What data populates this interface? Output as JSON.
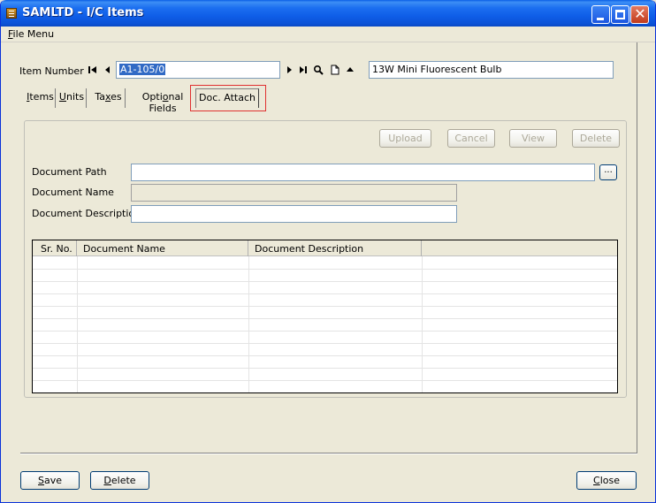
{
  "window": {
    "title": "SAMLTD - I/C Items",
    "accent": "#0a5fe6"
  },
  "menu": {
    "file_menu_u": "F",
    "file_menu_rest": "ile Menu"
  },
  "item": {
    "label": "Item Number",
    "number": "A1-105/0",
    "description": "13W Mini Fluorescent Bulb"
  },
  "tabs": [
    {
      "pre": "",
      "u": "I",
      "post": "tems"
    },
    {
      "pre": "",
      "u": "U",
      "post": "nits"
    },
    {
      "pre": "Ta",
      "u": "x",
      "post": "es"
    },
    {
      "pre": "Opti",
      "u": "o",
      "post": "nal Fields"
    },
    {
      "pre": "Doc. Attach",
      "u": "",
      "post": ""
    }
  ],
  "actions": {
    "upload": "Upload",
    "cancel": "Cancel",
    "view": "View",
    "delete": "Delete"
  },
  "form": {
    "document_path_label": "Document Path",
    "document_name_label": "Document Name",
    "document_description_label": "Document Description",
    "browse_label": "..."
  },
  "table": {
    "columns": [
      "Sr. No.",
      "Document Name",
      "Document Description"
    ]
  },
  "footer": {
    "save_u": "S",
    "save_rest": "ave",
    "delete_u": "D",
    "delete_rest": "elete",
    "close_u": "C",
    "close_rest": "lose"
  }
}
